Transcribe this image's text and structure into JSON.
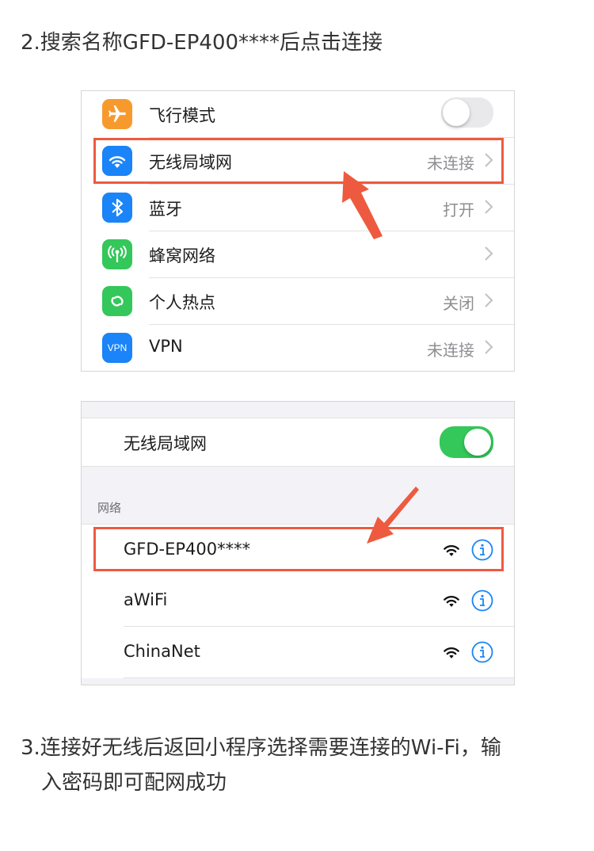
{
  "steps": {
    "step2": "2.搜索名称GFD-EP400****后点击连接",
    "step3_line1": "3.连接好无线后返回小程序选择需要连接的Wi-Fi，输",
    "step3_line2": "入密码即可配网成功"
  },
  "settings": {
    "items": [
      {
        "label": "飞行模式",
        "value": "",
        "icon": "airplane-icon",
        "color": "#f79a2e"
      },
      {
        "label": "无线局域网",
        "value": "未连接",
        "icon": "wifi-icon",
        "color": "#1a84f8"
      },
      {
        "label": "蓝牙",
        "value": "打开",
        "icon": "bluetooth-icon",
        "color": "#1a84f8"
      },
      {
        "label": "蜂窝网络",
        "value": "",
        "icon": "antenna-icon",
        "color": "#34c759"
      },
      {
        "label": "个人热点",
        "value": "关闭",
        "icon": "hotspot-icon",
        "color": "#34c759"
      },
      {
        "label": "VPN",
        "value": "未连接",
        "icon": "vpn-icon",
        "color": "#1a84f8"
      }
    ],
    "vpn_icon_text": "VPN"
  },
  "wifi": {
    "toggle_label": "无线局域网",
    "section_header": "网络",
    "networks": [
      "GFD-EP400****",
      "aWiFi",
      "ChinaNet"
    ],
    "toggle_color": "#34c759",
    "highlight_color": "#ee5a3f",
    "info_color": "#1a84f8"
  }
}
